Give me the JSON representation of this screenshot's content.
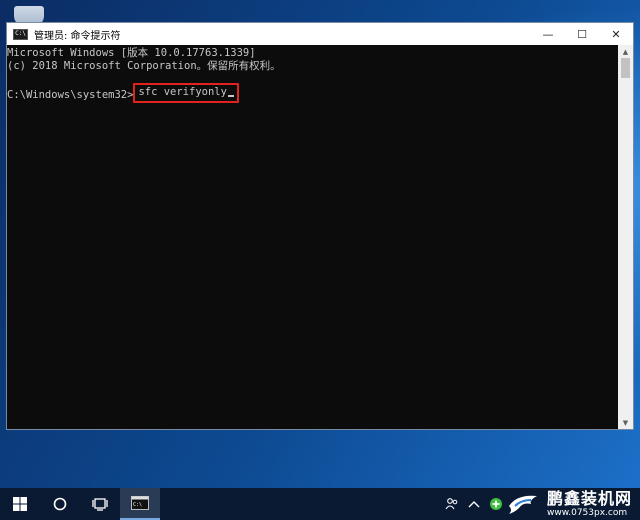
{
  "window": {
    "title": "管理员: 命令提示符",
    "controls": {
      "minimize": "—",
      "maximize": "☐",
      "close": "✕"
    },
    "icon_label": "C:\\"
  },
  "console": {
    "lines": [
      "Microsoft Windows [版本 10.0.17763.1339]",
      "(c) 2018 Microsoft Corporation。保留所有权利。"
    ],
    "prompt": "C:\\Windows\\system32>",
    "command": "sfc verifyonly",
    "highlight_color": "#e0231f"
  },
  "taskbar": {
    "icons": [
      "windows-start-icon",
      "search-circle-icon",
      "task-view-icon",
      "cmd-icon"
    ],
    "tray_icons": [
      "people-icon",
      "chevron-up-icon",
      "network-badge-icon"
    ]
  },
  "watermark": {
    "title": "鹏鑫装机网",
    "url": "www.0753px.com"
  }
}
